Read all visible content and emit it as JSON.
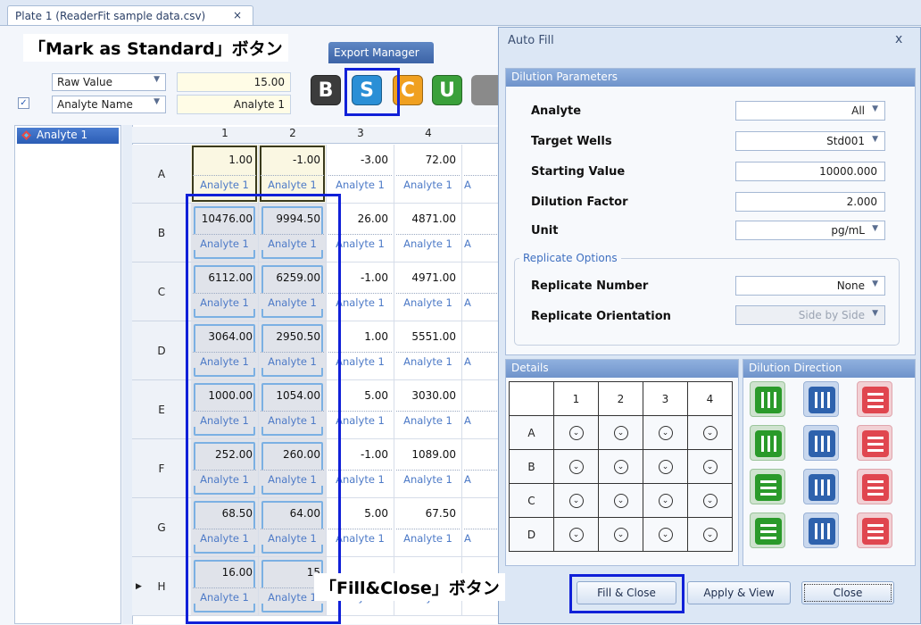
{
  "tab": {
    "title": "Plate 1 (ReaderFit sample data.csv)",
    "close": "×"
  },
  "ribbon": {
    "export_manager": "Export Manager"
  },
  "toolbar": {
    "display_mode": "Raw Value",
    "display_value": "15.00",
    "name_mode": "Analyte Name",
    "name_value": "Analyte 1",
    "buttons": [
      "B",
      "S",
      "C",
      "U"
    ],
    "button_colors": [
      "#3c3c3c",
      "#2a8fd6",
      "#f0a020",
      "#3aa03a"
    ]
  },
  "left_panel": {
    "item": "Analyte 1"
  },
  "plate": {
    "columns": [
      "1",
      "2",
      "3",
      "4"
    ],
    "rows": [
      {
        "label": "A",
        "values": [
          "1.00",
          "-1.00",
          "-3.00",
          "72.00"
        ]
      },
      {
        "label": "B",
        "values": [
          "10476.00",
          "9994.50",
          "26.00",
          "4871.00"
        ]
      },
      {
        "label": "C",
        "values": [
          "6112.00",
          "6259.00",
          "-1.00",
          "4971.00"
        ]
      },
      {
        "label": "D",
        "values": [
          "3064.00",
          "2950.50",
          "1.00",
          "5551.00"
        ]
      },
      {
        "label": "E",
        "values": [
          "1000.00",
          "1054.00",
          "5.00",
          "3030.00"
        ]
      },
      {
        "label": "F",
        "values": [
          "252.00",
          "260.00",
          "-1.00",
          "1089.00"
        ]
      },
      {
        "label": "G",
        "values": [
          "68.50",
          "64.00",
          "5.00",
          "67.50"
        ]
      },
      {
        "label": "H",
        "values": [
          "16.00",
          "15",
          "",
          ""
        ]
      }
    ],
    "cell_label": "Analyte 1",
    "cut_label": "A"
  },
  "dialog": {
    "title": "Auto Fill",
    "close": "x",
    "params_header": "Dilution Parameters",
    "analyte": {
      "label": "Analyte",
      "value": "All"
    },
    "target_wells": {
      "label": "Target Wells",
      "value": "Std001"
    },
    "starting_value": {
      "label": "Starting Value",
      "value": "10000.000"
    },
    "dilution_factor": {
      "label": "Dilution Factor",
      "value": "2.000"
    },
    "unit": {
      "label": "Unit",
      "value": "pg/mL"
    },
    "replicate_options": "Replicate Options",
    "replicate_number": {
      "label": "Replicate Number",
      "value": "None"
    },
    "replicate_orientation": {
      "label": "Replicate Orientation",
      "value": "Side by Side"
    },
    "details_header": "Details",
    "details_cols": [
      "1",
      "2",
      "3",
      "4"
    ],
    "details_rows": [
      "A",
      "B",
      "C",
      "D"
    ],
    "direction_header": "Dilution Direction",
    "fill_close": "Fill & Close",
    "apply_view": "Apply & View",
    "close_btn": "Close"
  },
  "annotations": {
    "mark_standard": "「Mark as Standard」ボタン",
    "fill_close": "「Fill&Close」ボタン"
  }
}
